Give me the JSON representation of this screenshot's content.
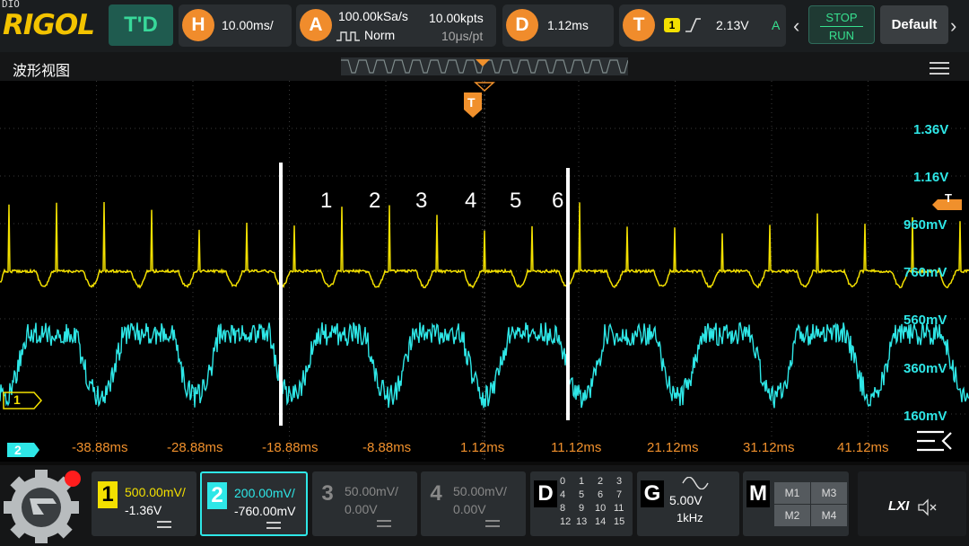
{
  "app": {
    "dio_label": "DIO",
    "brand": "RIGOL",
    "mode": "T'D"
  },
  "horizontal": {
    "icon_letter": "H",
    "timebase": "10.00ms/"
  },
  "acquire": {
    "icon_letter": "A",
    "sample_rate": "100.00kSa/s",
    "mode": "Norm",
    "memory": "10.00kpts",
    "resolution": "10μs/pt"
  },
  "delay": {
    "icon_letter": "D",
    "value": "1.12ms"
  },
  "trigger": {
    "icon_letter": "T",
    "source": "1",
    "level": "2.13V",
    "mode_letter": "A"
  },
  "controls": {
    "stop_label": "STOP",
    "run_label": "RUN",
    "default_label": "Default"
  },
  "waveform_view": {
    "title": "波形视图"
  },
  "scale_labels": [
    "1.36V",
    "1.16V",
    "960mV",
    "760mV",
    "560mV",
    "360mV",
    "160mV"
  ],
  "time_labels": [
    "-38.88ms",
    "-28.88ms",
    "-18.88ms",
    "-8.88ms",
    "1.12ms",
    "11.12ms",
    "21.12ms",
    "31.12ms",
    "41.12ms"
  ],
  "markers": {
    "trigger_marker": "T",
    "ch1_marker": "1",
    "ch2_marker": "2"
  },
  "annotations": [
    "1",
    "2",
    "3",
    "4",
    "5",
    "6"
  ],
  "channels": [
    {
      "num": "1",
      "scale": "500.00mV/",
      "offset": "-1.36V",
      "color": "#f3e000",
      "active": true
    },
    {
      "num": "2",
      "scale": "200.00mV/",
      "offset": "-760.00mV",
      "color": "#2ee7e7",
      "active": true
    },
    {
      "num": "3",
      "scale": "50.00mV/",
      "offset": "0.00V",
      "color": "#888888",
      "active": false
    },
    {
      "num": "4",
      "scale": "50.00mV/",
      "offset": "0.00V",
      "color": "#888888",
      "active": false
    }
  ],
  "digital": {
    "letter": "D",
    "channels": [
      "0",
      "1",
      "2",
      "3",
      "4",
      "5",
      "6",
      "7",
      "8",
      "9",
      "10",
      "11",
      "12",
      "13",
      "14",
      "15"
    ]
  },
  "generator": {
    "letter": "G",
    "amplitude": "5.00V",
    "frequency": "1kHz"
  },
  "math": {
    "letter": "M",
    "items": [
      "M1",
      "M3",
      "M2",
      "M4"
    ]
  },
  "status": {
    "lxi": "LXI"
  },
  "colors": {
    "ch1": "#f3e000",
    "ch2": "#2ee7e7",
    "trigger": "#f0902c",
    "accent": "#37e08f"
  }
}
